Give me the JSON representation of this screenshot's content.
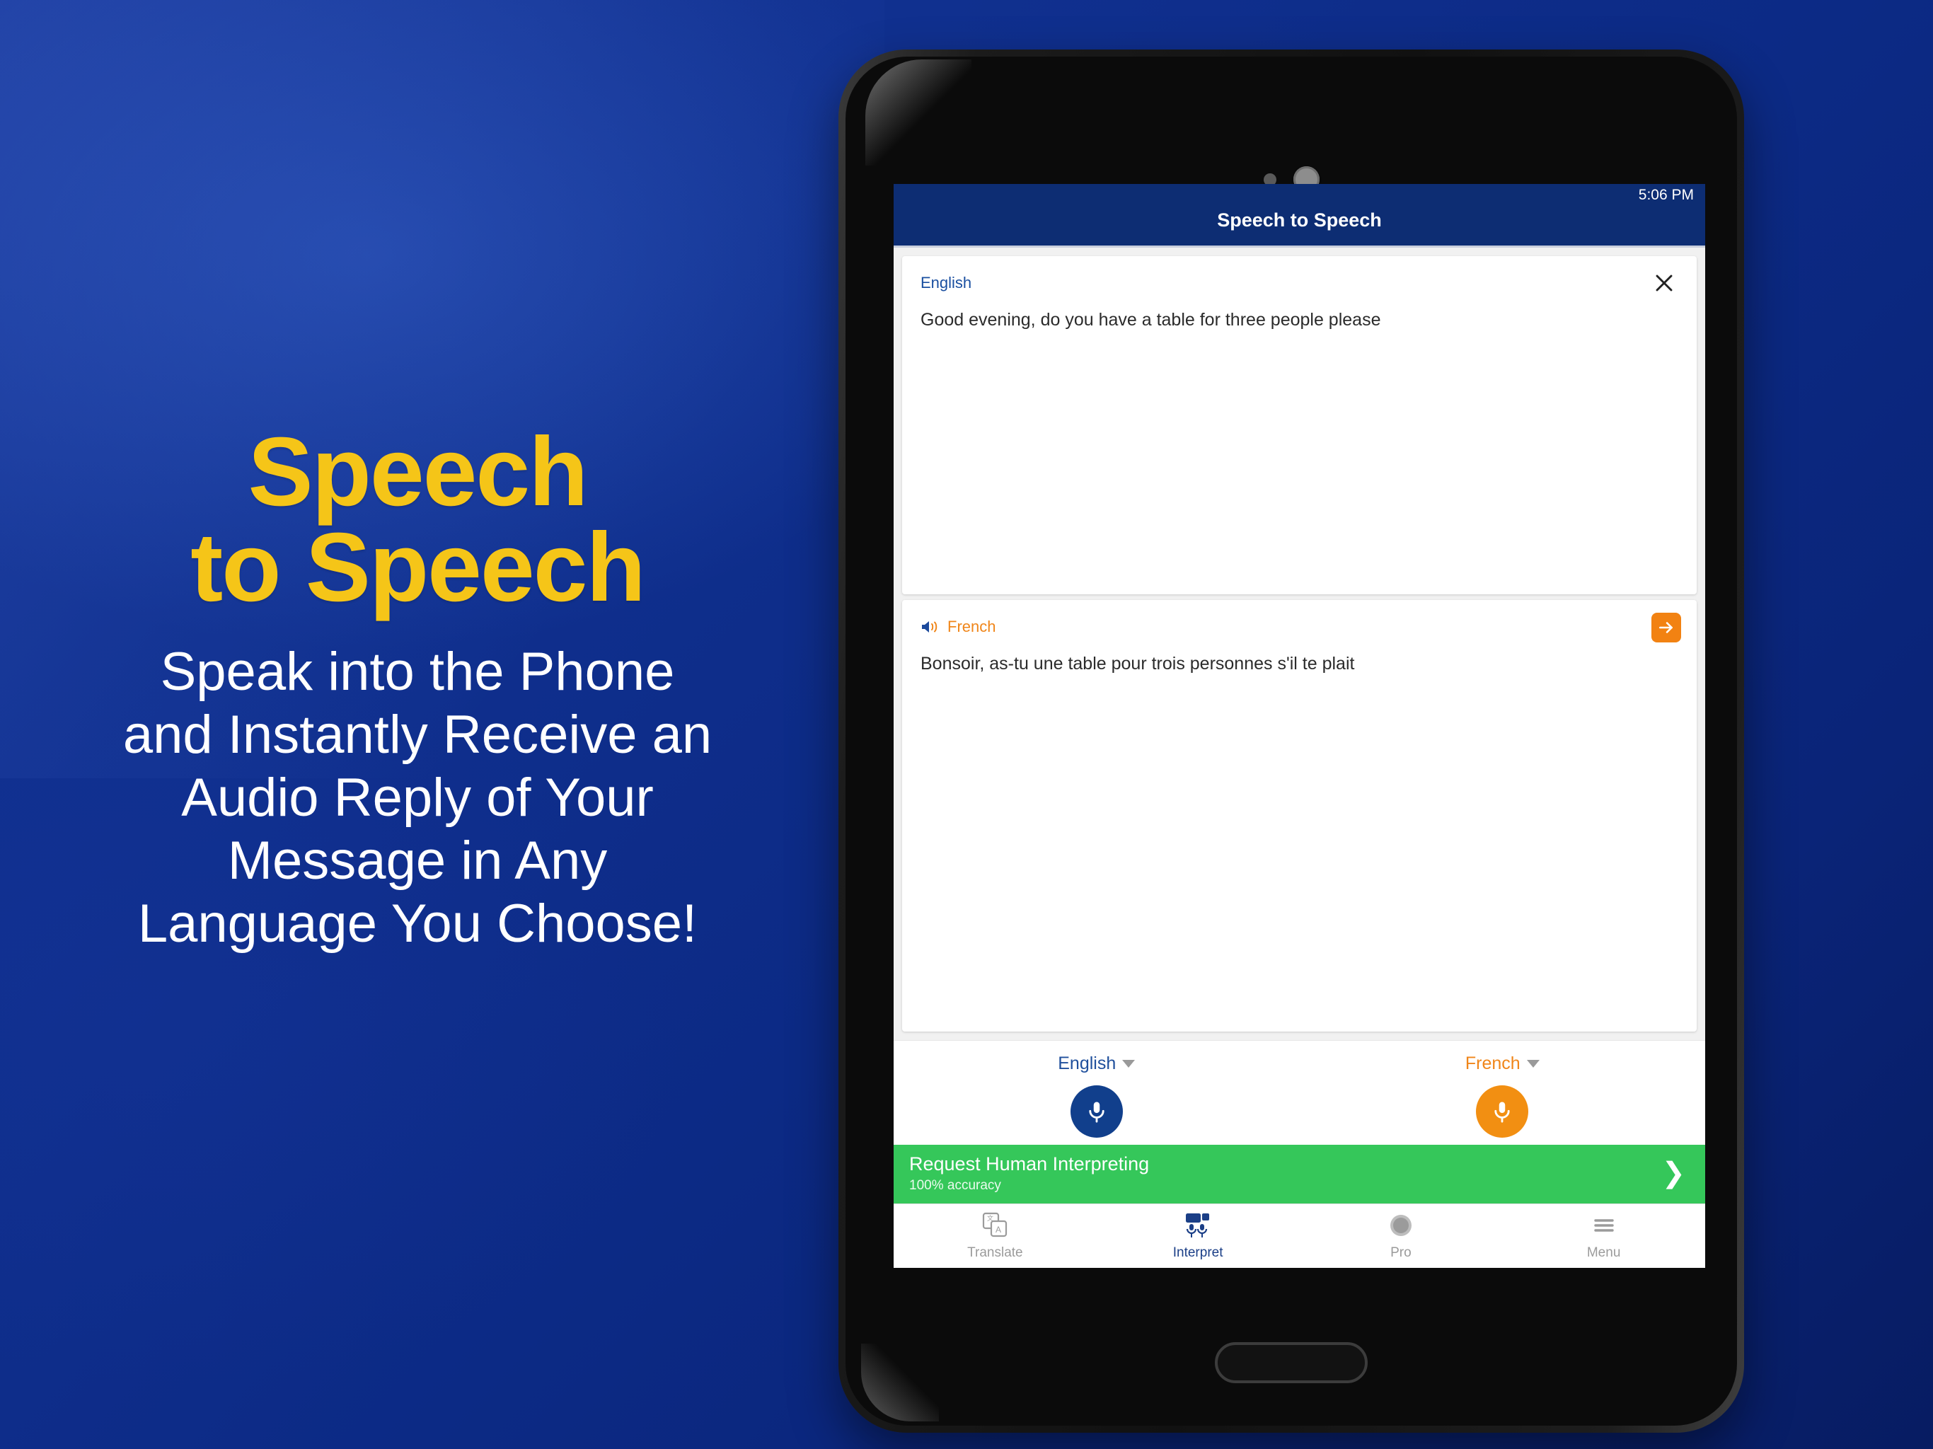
{
  "promo": {
    "title": "Speech\nto Speech",
    "subtitle": "Speak into the Phone\nand Instantly Receive an\nAudio Reply of Your\nMessage in Any\nLanguage You Choose!",
    "title_color": "#F5C518",
    "background_color": "#0c2a85"
  },
  "app": {
    "status_time": "5:06 PM",
    "title": "Speech to Speech",
    "appbar_color": "#0d2d73",
    "source": {
      "language": "English",
      "text": "Good evening, do you have a table for three people please",
      "close_icon": "close-icon"
    },
    "target": {
      "language": "French",
      "text": "Bonsoir, as-tu une table pour trois personnes s'il te plait",
      "speaker_icon": "speaker-icon",
      "go_icon": "arrow-right-icon",
      "accent_color": "#f0861a"
    },
    "controls": {
      "source_language": "English",
      "target_language": "French",
      "source_mic_icon": "microphone-icon",
      "target_mic_icon": "microphone-icon",
      "source_mic_color": "#113f8c",
      "target_mic_color": "#f28f12"
    },
    "banner": {
      "title": "Request Human Interpreting",
      "subtitle": "100% accuracy",
      "chevron": "❯",
      "color": "#35c75a"
    },
    "tabs": [
      {
        "label": "Translate",
        "icon": "translate-icon",
        "active": false
      },
      {
        "label": "Interpret",
        "icon": "interpret-icon",
        "active": true
      },
      {
        "label": "Pro",
        "icon": "pro-badge-icon",
        "active": false
      },
      {
        "label": "Menu",
        "icon": "hamburger-menu-icon",
        "active": false
      }
    ]
  }
}
